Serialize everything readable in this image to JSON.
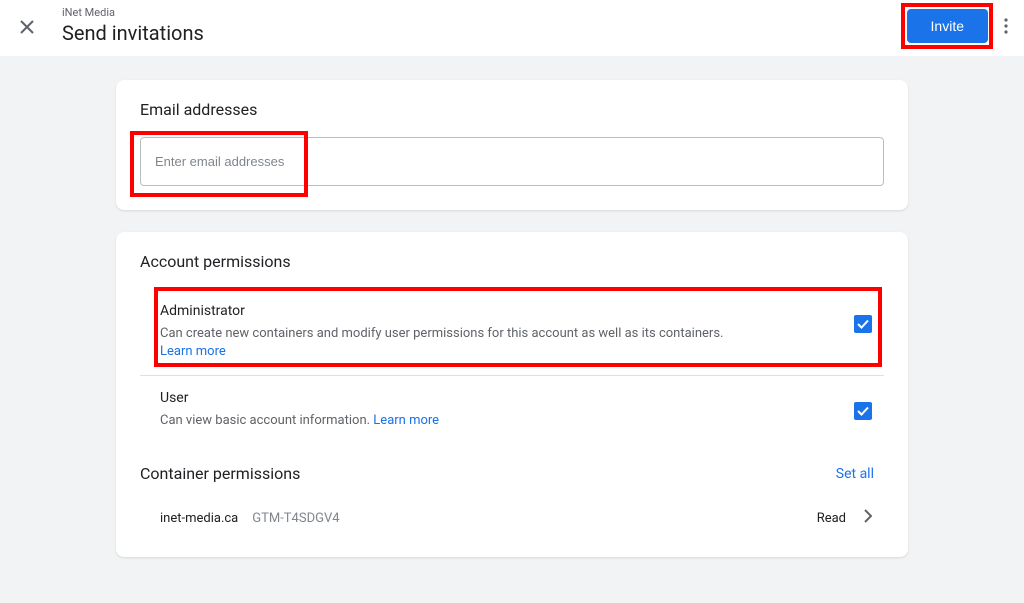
{
  "header": {
    "subtitle": "iNet Media",
    "title": "Send invitations",
    "invite_label": "Invite"
  },
  "email_section": {
    "title": "Email addresses",
    "placeholder": "Enter email addresses"
  },
  "account_permissions": {
    "title": "Account permissions",
    "admin": {
      "name": "Administrator",
      "desc": "Can create new containers and modify user permissions for this account as well as its containers.",
      "learn_more": "Learn more",
      "checked": true
    },
    "user": {
      "name": "User",
      "desc": "Can view basic account information.",
      "learn_more": "Learn more",
      "checked": true
    }
  },
  "container_permissions": {
    "title": "Container permissions",
    "set_all": "Set all",
    "items": [
      {
        "name": "inet-media.ca",
        "id": "GTM-T4SDGV4",
        "access": "Read"
      }
    ]
  }
}
